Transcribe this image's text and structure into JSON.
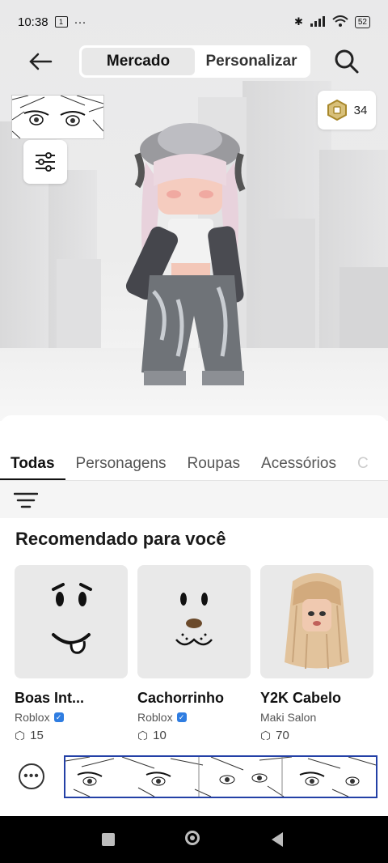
{
  "status_bar": {
    "time": "10:38",
    "notification_badge": "1",
    "more": "···",
    "battery": "52"
  },
  "header": {
    "back_icon": "arrow-left-icon",
    "tabs": [
      {
        "label": "Mercado",
        "active": true
      },
      {
        "label": "Personalizar",
        "active": false
      }
    ],
    "search_icon": "search-icon"
  },
  "robux": {
    "amount": "34"
  },
  "categories": [
    {
      "label": "Todas",
      "active": true
    },
    {
      "label": "Personagens"
    },
    {
      "label": "Roupas"
    },
    {
      "label": "Acessórios"
    },
    {
      "label": "C"
    }
  ],
  "section": {
    "title": "Recomendado para você"
  },
  "items": [
    {
      "name": "Boas Int...",
      "creator": "Roblox",
      "verified": true,
      "price": "15"
    },
    {
      "name": "Cachorrinho",
      "creator": "Roblox",
      "verified": true,
      "price": "10"
    },
    {
      "name": "Y2K Cabelo",
      "creator": "Maki Salon",
      "verified": false,
      "price": "70"
    }
  ],
  "colors": {
    "active_tab_underline": "#111111",
    "verified_badge": "#2f7de1",
    "robux_gold": "#c9a227"
  }
}
